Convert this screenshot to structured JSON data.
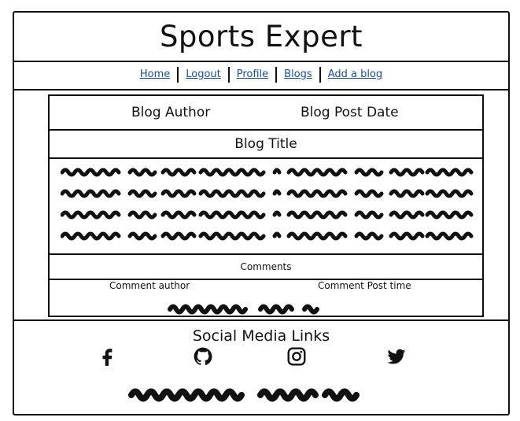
{
  "header": {
    "title": "Sports Expert"
  },
  "nav": {
    "items": [
      {
        "label": "Home"
      },
      {
        "label": "Logout"
      },
      {
        "label": "Profile"
      },
      {
        "label": "Blogs"
      },
      {
        "label": "Add a blog"
      }
    ]
  },
  "blog": {
    "author_label": "Blog Author",
    "date_label": "Blog Post Date",
    "title_label": "Blog Title",
    "comments_label": "Comments",
    "comment_author_label": "Comment author",
    "comment_time_label": "Comment Post time"
  },
  "footer": {
    "social_title": "Social Media Links",
    "icons": [
      "facebook-icon",
      "github-icon",
      "instagram-icon",
      "twitter-icon"
    ]
  }
}
